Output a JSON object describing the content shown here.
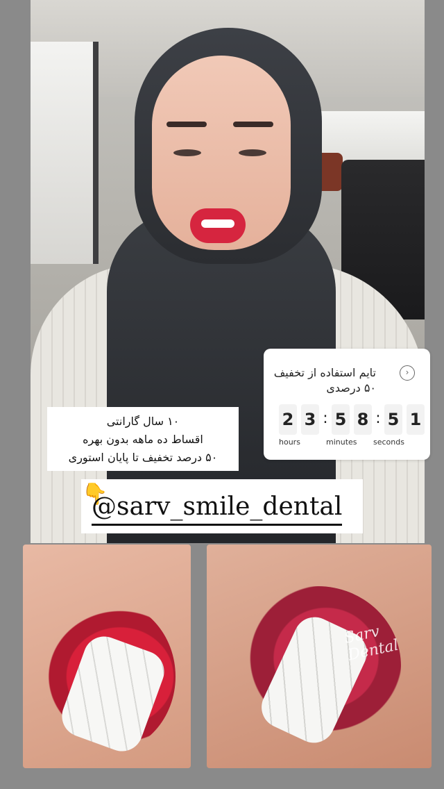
{
  "timer": {
    "title": "تایم استفاده از تخفیف ۵۰ درصدی",
    "digits": [
      "2",
      "3",
      "5",
      "8",
      "5",
      "1"
    ],
    "units": [
      "hours",
      "minutes",
      "seconds"
    ]
  },
  "info": {
    "lines": [
      "۱۰ سال گارانتی",
      "اقساط ده ماهه بدون بهره",
      "۵۰ درصد تخفیف تا پایان استوری"
    ]
  },
  "handle": {
    "text": "@sarv_smile_dental"
  },
  "photos": {
    "watermark": "Sarv Dental"
  },
  "icons": {
    "timer_arrow": "chevron-right-icon",
    "pointer": "pointing-hand-icon"
  }
}
